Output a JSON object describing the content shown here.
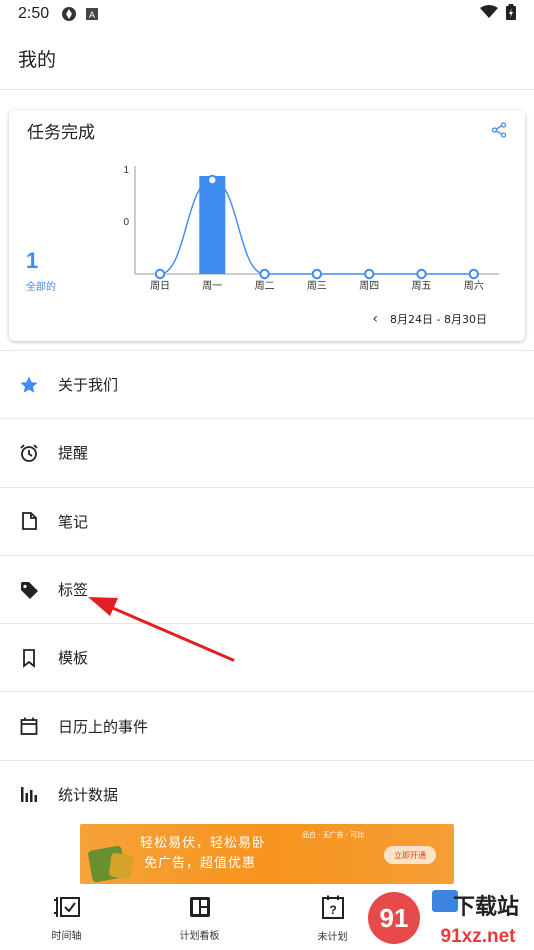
{
  "status": {
    "time": "2:50"
  },
  "app": {
    "title": "我的"
  },
  "card": {
    "title": "任务完成",
    "total": "1",
    "total_label": "全部的",
    "date_range": "8月24日 - 8月30日"
  },
  "chart_data": {
    "type": "bar",
    "categories": [
      "周日",
      "周一",
      "周二",
      "周三",
      "周四",
      "周五",
      "周六"
    ],
    "values": [
      0,
      1,
      0,
      0,
      0,
      0,
      0
    ],
    "ytick_labels": [
      "1",
      "0"
    ],
    "ylim": [
      0,
      1
    ],
    "grid": false,
    "overlay": "smoothed line with point markers",
    "color": "#3f8cf0"
  },
  "menu": {
    "items": [
      {
        "label": "关于我们",
        "icon": "star-icon"
      },
      {
        "label": "提醒",
        "icon": "alarm-icon"
      },
      {
        "label": "笔记",
        "icon": "note-icon"
      },
      {
        "label": "标签",
        "icon": "tag-icon"
      },
      {
        "label": "模板",
        "icon": "bookmark-icon"
      },
      {
        "label": "日历上的事件",
        "icon": "calendar-icon"
      },
      {
        "label": "统计数据",
        "icon": "bar-chart-icon"
      }
    ]
  },
  "ad": {
    "line1": "轻松易伏，轻松易卧",
    "line2": "免广告，超值优惠",
    "tags": "品白 · 无广告 · 可比",
    "button": "立即开通"
  },
  "nav": {
    "items": [
      {
        "label": "时间轴"
      },
      {
        "label": "计划看板"
      },
      {
        "label": "未计划"
      }
    ]
  },
  "watermark": {
    "brand": "下载站",
    "site": "91xz.net"
  },
  "colors": {
    "accent": "#3f8cf0",
    "arrow": "#e02020"
  }
}
